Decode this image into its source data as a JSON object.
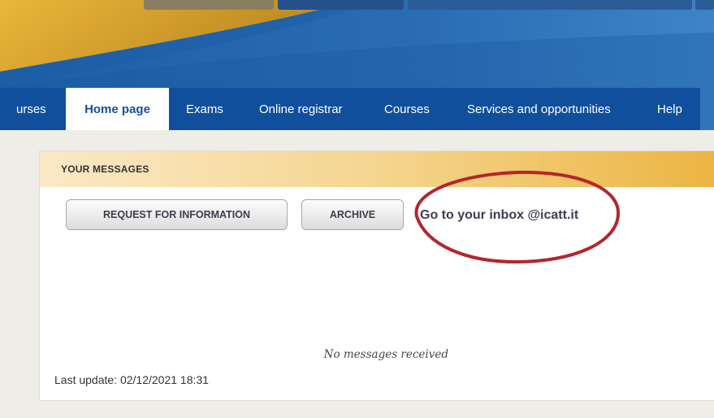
{
  "colors": {
    "nav_bg": "#104f9b",
    "banner_blue": "#1e63a8",
    "banner_gold": "#d9a328",
    "panel_header_gold": "#ecb543",
    "annotation_red": "#b3262d"
  },
  "nav": {
    "items": [
      {
        "label": "urses"
      },
      {
        "label": "Home page",
        "active": true
      },
      {
        "label": "Exams"
      },
      {
        "label": "Online registrar"
      },
      {
        "label": "Courses"
      },
      {
        "label": "Services and opportunities"
      },
      {
        "label": "Help"
      }
    ]
  },
  "messages": {
    "title": "YOUR MESSAGES",
    "request_button": "REQUEST FOR INFORMATION",
    "archive_button": "ARCHIVE",
    "inbox_link": "Go to your inbox @icatt.it",
    "empty_text": "No messages received",
    "last_update": "Last update: 02/12/2021 18:31"
  },
  "annotation": {
    "shape": "ellipse-highlight",
    "target": "inbox-link"
  }
}
